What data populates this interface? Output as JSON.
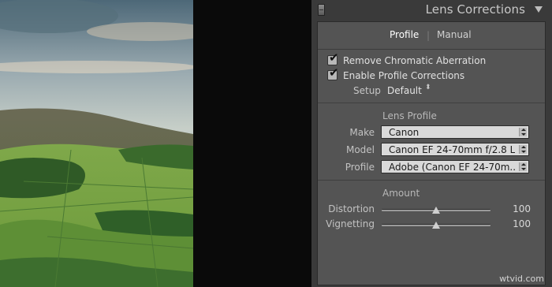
{
  "panel": {
    "title": "Lens Corrections",
    "tabs": [
      {
        "label": "Profile",
        "active": true
      },
      {
        "label": "Manual",
        "active": false
      }
    ],
    "tab_separator": "|",
    "checkboxes": [
      {
        "label": "Remove Chromatic Aberration",
        "checked": true
      },
      {
        "label": "Enable Profile Corrections",
        "checked": true
      }
    ],
    "setup": {
      "label": "Setup",
      "value": "Default",
      "arrows": "⬍"
    },
    "lens_profile": {
      "title": "Lens Profile",
      "fields": [
        {
          "label": "Make",
          "value": "Canon"
        },
        {
          "label": "Model",
          "value": "Canon EF 24-70mm f/2.8 L..."
        },
        {
          "label": "Profile",
          "value": "Adobe (Canon EF 24-70m..."
        }
      ]
    },
    "amount": {
      "title": "Amount",
      "sliders": [
        {
          "label": "Distortion",
          "value": "100",
          "fraction": 0.5
        },
        {
          "label": "Vignetting",
          "value": "100",
          "fraction": 0.5
        }
      ]
    }
  },
  "photo": {
    "description_icon": "landscape-photo"
  },
  "watermark": "wtvid.com",
  "colors": {
    "panel_bg": "#545454",
    "header_bg": "#3a3a3a",
    "select_bg": "#d9d9d9",
    "sky": "#9fc0c4",
    "grass": "#6f9a3c"
  }
}
